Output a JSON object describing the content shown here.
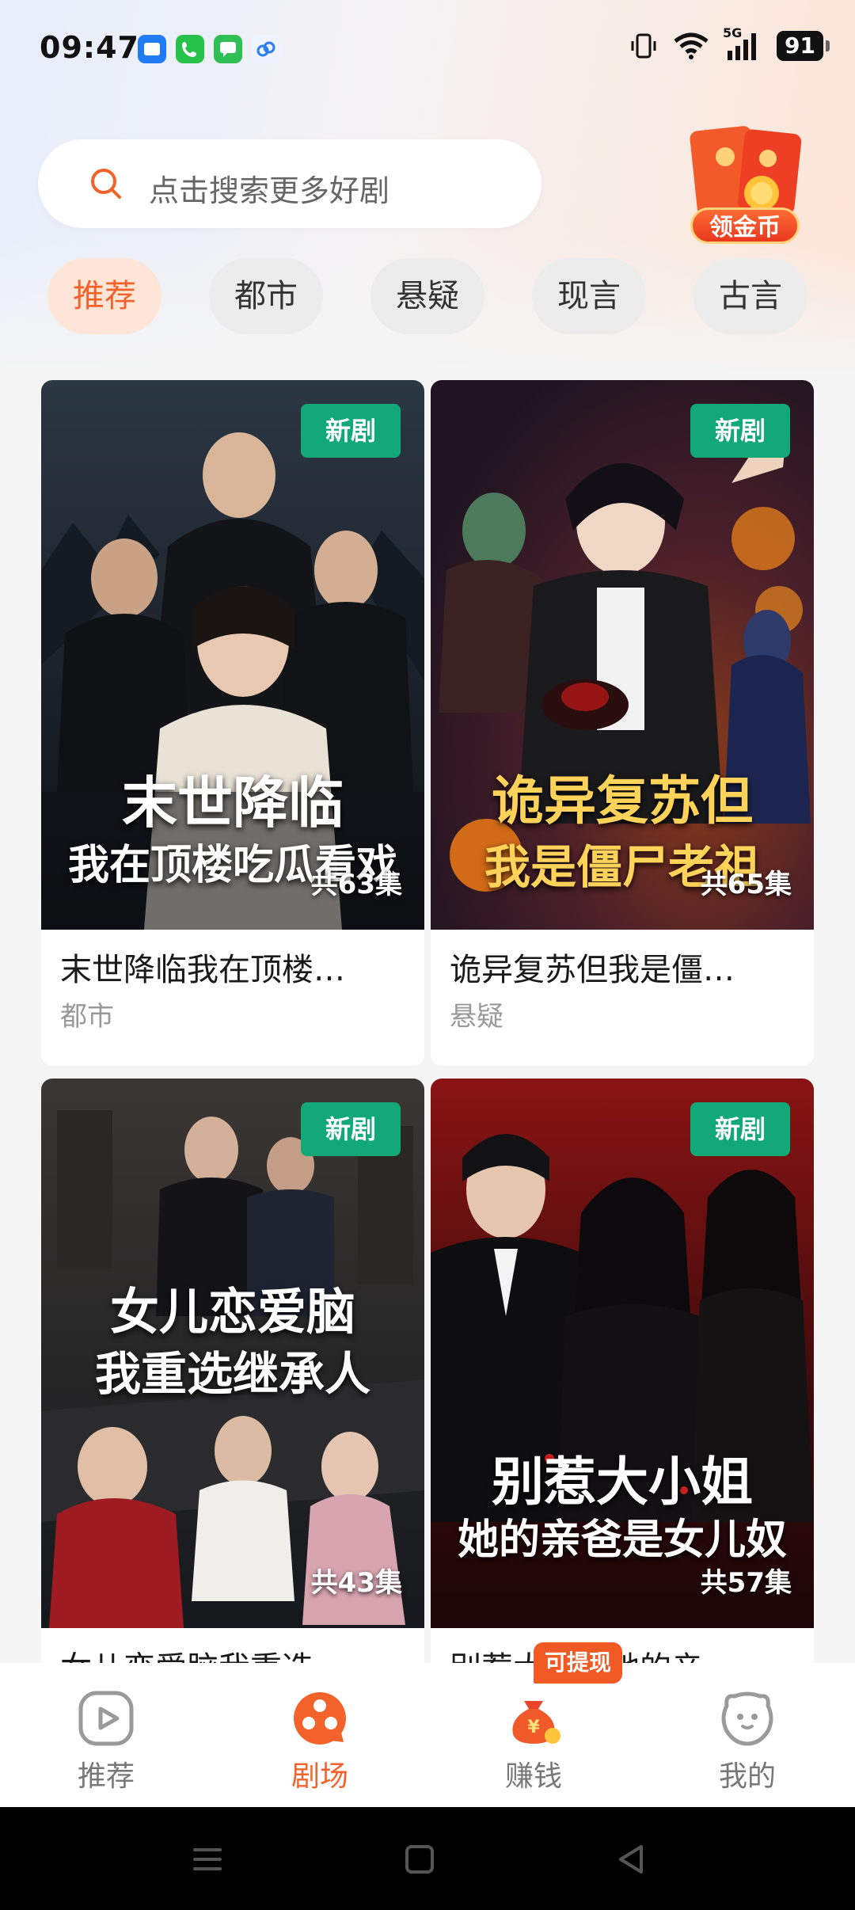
{
  "status_bar": {
    "time": "09:47",
    "network": "5G",
    "battery": "91"
  },
  "search": {
    "placeholder": "点击搜索更多好剧"
  },
  "promo": {
    "label": "领金币"
  },
  "categories": [
    {
      "label": "推荐",
      "active": true
    },
    {
      "label": "都市",
      "active": false
    },
    {
      "label": "悬疑",
      "active": false
    },
    {
      "label": "现言",
      "active": false
    },
    {
      "label": "古言",
      "active": false
    }
  ],
  "dramas": [
    {
      "badge": "新剧",
      "poster_title_line1": "末世降临",
      "poster_title_line2": "我在顶楼吃瓜看戏",
      "episodes": "共63集",
      "title": "末世降临我在顶楼…",
      "genre": "都市"
    },
    {
      "badge": "新剧",
      "poster_title_line1": "诡异复苏但",
      "poster_title_line2": "我是僵尸老祖",
      "episodes": "共65集",
      "title": "诡异复苏但我是僵…",
      "genre": "悬疑"
    },
    {
      "badge": "新剧",
      "poster_title_line1": "女儿恋爱脑",
      "poster_title_line2": "我重选继承人",
      "episodes": "共43集",
      "title": "女儿恋爱脑我重选…",
      "genre": ""
    },
    {
      "badge": "新剧",
      "poster_title_line1": "别惹大小姐",
      "poster_title_line2": "她的亲爸是女儿奴",
      "episodes": "共57集",
      "title": "别惹大小姐她的亲…",
      "genre": ""
    }
  ],
  "bottom_nav": {
    "items": [
      {
        "label": "推荐",
        "icon": "play-icon",
        "active": false
      },
      {
        "label": "剧场",
        "icon": "theater-icon",
        "active": true
      },
      {
        "label": "赚钱",
        "icon": "money-bag-icon",
        "active": false
      },
      {
        "label": "我的",
        "icon": "profile-face-icon",
        "active": false
      }
    ],
    "withdraw_badge": "可提现"
  },
  "colors": {
    "accent": "#f2622a",
    "new_badge": "#12a878"
  }
}
